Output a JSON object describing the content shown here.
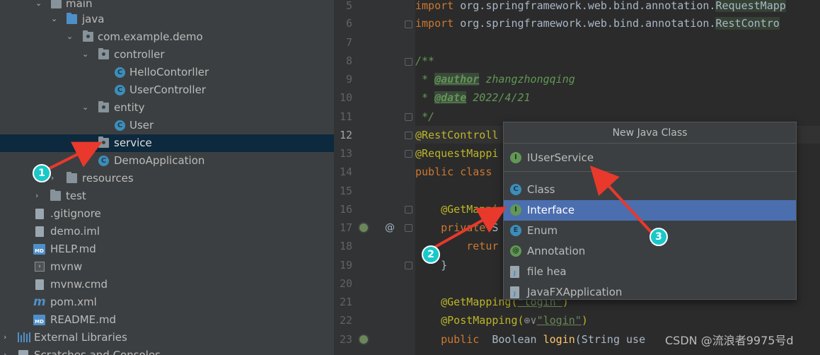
{
  "project_tree": {
    "items": [
      {
        "label": "main",
        "icon": "folder-icon"
      },
      {
        "label": "java",
        "icon": "folder-icon"
      },
      {
        "label": "com.example.demo",
        "icon": "package-icon"
      },
      {
        "label": "controller",
        "icon": "package-icon"
      },
      {
        "label": "HelloContorller",
        "icon": "class-icon"
      },
      {
        "label": "UserController",
        "icon": "class-icon"
      },
      {
        "label": "entity",
        "icon": "package-icon"
      },
      {
        "label": "User",
        "icon": "class-icon"
      },
      {
        "label": "service",
        "icon": "package-icon"
      },
      {
        "label": "DemoApplication",
        "icon": "spring-class-icon"
      },
      {
        "label": "resources",
        "icon": "folder-icon"
      },
      {
        "label": "test",
        "icon": "folder-icon"
      },
      {
        "label": ".gitignore",
        "icon": "file-icon"
      },
      {
        "label": "demo.iml",
        "icon": "file-icon"
      },
      {
        "label": "HELP.md",
        "icon": "markdown-icon"
      },
      {
        "label": "mvnw",
        "icon": "terminal-icon"
      },
      {
        "label": "mvnw.cmd",
        "icon": "file-icon"
      },
      {
        "label": "pom.xml",
        "icon": "maven-icon"
      },
      {
        "label": "README.md",
        "icon": "markdown-icon"
      },
      {
        "label": "External Libraries",
        "icon": "library-icon"
      },
      {
        "label": "Scratches and Consoles",
        "icon": "scratch-icon"
      }
    ],
    "selected": "service"
  },
  "editor": {
    "line_numbers": [
      "5",
      "6",
      "7",
      "8",
      "9",
      "10",
      "11",
      "12",
      "13",
      "14",
      "15",
      "16",
      "17",
      "18",
      "19",
      "20",
      "21",
      "22",
      "23"
    ],
    "current_line": "12",
    "lines": {
      "l5_kw": "import",
      "l5_rest": " org.springframework.web.bind.annotation.",
      "l5_hl": "RequestMapp",
      "l6_kw": "import",
      "l6_rest": " org.springframework.web.bind.annotation.",
      "l6_hl": "RestContro",
      "l8": "/**",
      "l9_pre": " * ",
      "l9_tag": "@author",
      "l9_val": " zhangzhongqing",
      "l10_pre": " * ",
      "l10_tag": "@date",
      "l10_val": " 2022/4/21",
      "l11": " */",
      "l12": "@RestControll",
      "l13": "@RequestMappi",
      "l14_kw": "public class",
      "l16": "    @GetMappi",
      "l17_kw": "    private",
      "l17_rest": " S",
      "l18_kw": "        retur",
      "l19": "    }",
      "l21_an": "    @GetMapping(",
      "l21_str": "\"login\"",
      "l21_end": ")",
      "l22_an": "    @PostMapping(",
      "l22_globe": "⊕∨",
      "l22_str": "\"login\"",
      "l22_end": ")",
      "l23_kw": "    public",
      "l23_type": "  Boolean ",
      "l23_fn": "login",
      "l23_rest": "(String use"
    }
  },
  "popup": {
    "title": "New Java Class",
    "name_value": "IUserService",
    "name_icon": "interface-icon",
    "options": [
      {
        "label": "Class",
        "icon_char": "C"
      },
      {
        "label": "Interface",
        "icon_char": "I"
      },
      {
        "label": "Enum",
        "icon_char": "E"
      },
      {
        "label": "Annotation",
        "icon_char": "@"
      },
      {
        "label": "file hea",
        "icon_char": "J"
      },
      {
        "label": "JavaFXApplication",
        "icon_char": "J"
      }
    ],
    "selected": "Interface"
  },
  "annotations": {
    "badges": [
      "1",
      "2",
      "3"
    ],
    "arrow_color": "#e8392c",
    "badge_color": "#19c8c8"
  },
  "watermark": "CSDN @流浪者9975号d"
}
